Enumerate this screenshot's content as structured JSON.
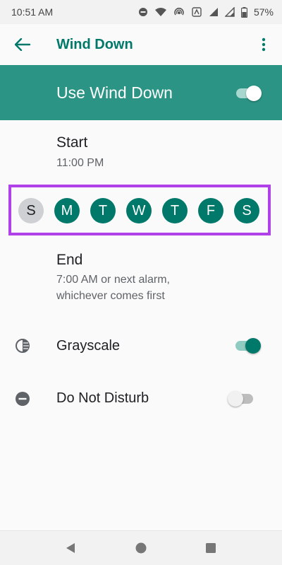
{
  "status_bar": {
    "time": "10:51 AM",
    "battery": "57%",
    "icons": [
      "dnd-icon",
      "wifi-icon",
      "hotspot-icon",
      "data-icon",
      "signal-icon",
      "signal-icon",
      "battery-icon"
    ]
  },
  "app_bar": {
    "title": "Wind Down",
    "back_icon": "arrow-back-icon",
    "more_icon": "more-vert-icon"
  },
  "master_switch": {
    "label": "Use Wind Down",
    "on": true
  },
  "start": {
    "title": "Start",
    "value": "11:00 PM"
  },
  "days": [
    {
      "label": "S",
      "on": false
    },
    {
      "label": "M",
      "on": true
    },
    {
      "label": "T",
      "on": true
    },
    {
      "label": "W",
      "on": true
    },
    {
      "label": "T",
      "on": true
    },
    {
      "label": "F",
      "on": true
    },
    {
      "label": "S",
      "on": true
    }
  ],
  "end": {
    "title": "End",
    "line1": "7:00 AM or next alarm,",
    "line2": "whichever comes first"
  },
  "grayscale": {
    "label": "Grayscale",
    "icon": "contrast-icon",
    "on": true
  },
  "dnd": {
    "label": "Do Not Disturb",
    "icon": "minus-circle-icon",
    "on": false
  },
  "colors": {
    "accent": "#00796b",
    "master_bg": "#2b9484",
    "highlight_border": "#b040e8",
    "day_off": "#cfd0d4"
  },
  "nav": {
    "back": "nav-back-icon",
    "home": "nav-home-icon",
    "recents": "nav-recents-icon"
  }
}
